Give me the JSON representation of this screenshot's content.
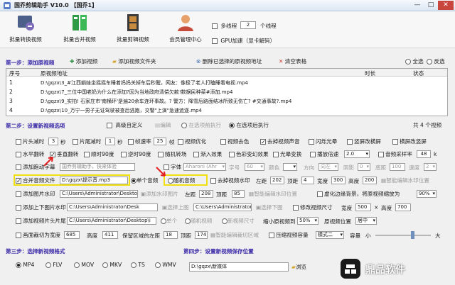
{
  "window": {
    "title": "国乔剪辑助手 V10.0 【国乔1】",
    "min": "—",
    "max": "□",
    "close": "✕"
  },
  "toolbar": {
    "items": [
      "批量转换视频",
      "批量合并视频",
      "批量剪辑视频",
      "会员管理中心"
    ],
    "multithread_label": "多线程",
    "thread_count": "2",
    "thread_unit": "个线程",
    "gpu_label": "GPU加速（显卡解码）"
  },
  "step1": {
    "label": "第一步：添加原视频",
    "add_video": "添加视频",
    "add_folder": "添加视频文件夹",
    "delete_selected": "删除已选择的原视频地址",
    "clear_table": "清空表格",
    "select_all": "全选",
    "invert": "反选",
    "columns": [
      "序号",
      "原视频地址",
      "时长",
      "状态"
    ],
    "rows": [
      {
        "no": "1",
        "path": "D:\\gqzx\\3_#江西躺娃坐摇摇车睡着妈妈关掉车后秒醒，网友：像极了老人打瞌睡看电视.mp4"
      },
      {
        "no": "2",
        "path": "D:\\gqzx\\7_三位中国老奶为什么在添加?因为当地政府清偿欠款!数据民种菜#添加.mp4"
      },
      {
        "no": "3",
        "path": "D:\\gqzx\\9_实拍! 石家庄市'南横环'是遍20余车连环事故。? 警方：降雪后路面结冰所致无伤亡? #交通事故?.mp4"
      },
      {
        "no": "4",
        "path": "D:\\gqzx\\10_万宁一男子无证驾驶被查后逃跑，交警\"上演\"急速追逐.mp4"
      }
    ]
  },
  "step2": {
    "label": "第二步：设置新视频选项",
    "advanced": "高级自定义",
    "edit": "编辑",
    "on_selected": "在选项前执行",
    "after_selected": "在选项后执行",
    "total": "共 4 个视频",
    "opts": {
      "head_cut": "片头减时",
      "head_cut_val": "3",
      "sec1": "秒",
      "tail_cut": "片尾减时",
      "tail_cut_val": "1",
      "sec2": "秒",
      "fps": "帧速率",
      "fps_val": "25",
      "fps_unit": "帧",
      "optimize": "视频优化",
      "color": "视频去色",
      "remove_audio": "去掉视频声音",
      "flicker": "闪烁光晕",
      "vertical_blur": "竖屏改横屏",
      "horizontal": "横屏改竖屏",
      "hflip": "水平翻转",
      "vflip": "垂直翻转",
      "rot90": "顺时90度",
      "rot270": "逆时90度",
      "random_transition": "随机转场",
      "fade": "渐入效果",
      "color_change": "色彩变幻效果",
      "light_change": "光晕变换",
      "play_speed": "播放倍速",
      "speed_val": "2.0",
      "sample_rate": "音频采样率",
      "sample_rate_val": "48",
      "dynamic_subtitle": "添加跑动字幕",
      "subtitle_text": "国乔剪辑助手，快来体验",
      "font_label": "字体",
      "font_val": "Aharoni (Ahr",
      "size_label": "字号",
      "size_val": "60",
      "color_label": "颜色",
      "direction_label": "方向",
      "direction_val": "向左",
      "shadow_label": "阴影",
      "shadow_val": "0",
      "bottom_label": "底距",
      "bottom_val": "100",
      "speed_label": "速度",
      "speed_val2": "2",
      "bg_audio": "合并音频文件",
      "bg_audio_path": "D:\\gqzx\\提示音.mp3",
      "single_audio": "单个音频",
      "random_audio": "随机音频",
      "remove_watermark": "去掉视频水印",
      "wm_left": "左距",
      "wm_left_val": "202",
      "wm_top": "顶距",
      "wm_top_val": "4",
      "wm_w": "宽度",
      "wm_w_val": "300",
      "wm_h": "高度",
      "wm_h_val": "200",
      "auto_watermark": "智能编辑水印位置",
      "add_image": "添加图片水印",
      "img_path": "C:\\Users\\Administrator\\Desktop\\img-g",
      "add_image_watermark": "添加水印图片",
      "left2": "左距",
      "left2_val": "208",
      "top2": "顶距",
      "top2_val": "85",
      "auto_img": "智能编辑水印位置",
      "blur_bg": "虚化边缘背景，将原视频缩放为",
      "blur_val": "90%",
      "add_topbottom": "添加上下图片水印",
      "tb_path": "C:\\Users\\Administrator\\Desk",
      "up_img": "选择上图",
      "down_img_path": "C:\\Users\\Administrator\\Desk",
      "down_img": "选择下图",
      "modify_size": "修改视频尺寸",
      "width_label": "宽度",
      "width_val": "500",
      "mult": "×",
      "height_label": "高度",
      "height_val": "700",
      "add_video_head": "添加视频片头片尾",
      "head_path": "C:\\Users\\Administrator\\Desktop\\i",
      "single": "单个",
      "random": "随机视频",
      "new_video_size": "新视频尺寸",
      "shrink": "缩小原视频到",
      "shrink_val": "50%",
      "position": "原视频位置",
      "position_val": "居中",
      "crop": "画面裁切为宽度",
      "crop_w": "685",
      "crop_h_label": "高度",
      "crop_h": "411",
      "keep_left": "保留区域的左距",
      "keep_left_val": "18",
      "keep_top": "顶距",
      "keep_top_val": "174",
      "auto_crop": "智能编辑裁切区域",
      "compress": "压缩视频容量",
      "compress_mode": "模式二",
      "capacity": "容量",
      "small": "小",
      "large": "大"
    }
  },
  "step3": {
    "label": "第三步：选择新视频格式",
    "formats": [
      "MP4",
      "FLV",
      "MOV",
      "MKV",
      "TS",
      "WMV"
    ]
  },
  "step4": {
    "label": "第四步：设置新视频保存位置",
    "path": "D:\\gqzx\\新媒体",
    "browse": "浏览"
  },
  "watermark": {
    "brand": "鼎品软件"
  },
  "colors": {
    "section": "#3a2aa8",
    "highlight": "#f0e012",
    "titlebar": "#dbe6f3"
  }
}
